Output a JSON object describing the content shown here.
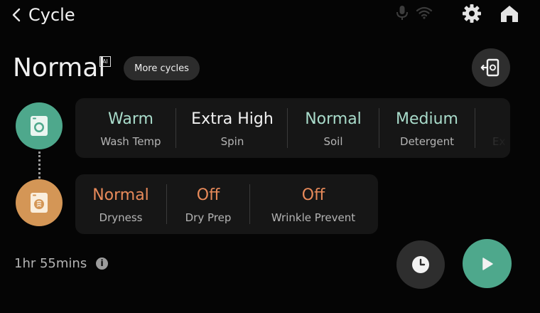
{
  "header": {
    "title": "Cycle"
  },
  "cycle": {
    "name": "Normal",
    "ai_badge": "AI",
    "more_cycles_label": "More cycles"
  },
  "washer": {
    "icon": "washer-icon",
    "options": [
      {
        "value": "Warm",
        "label": "Wash Temp",
        "color": "#a9dccb"
      },
      {
        "value": "Extra High",
        "label": "Spin",
        "color": "#f2f2f2"
      },
      {
        "value": "Normal",
        "label": "Soil",
        "color": "#a9dccb"
      },
      {
        "value": "Medium",
        "label": "Detergent",
        "color": "#a9dccb"
      },
      {
        "value": "",
        "label": "Ex",
        "color": "#a9dccb"
      }
    ]
  },
  "dryer": {
    "icon": "dryer-icon",
    "options": [
      {
        "value": "Normal",
        "label": "Dryness",
        "color": "#e88a5a"
      },
      {
        "value": "Off",
        "label": "Dry Prep",
        "color": "#e88a5a"
      },
      {
        "value": "Off",
        "label": "Wrinkle Prevent",
        "color": "#e88a5a"
      }
    ]
  },
  "footer": {
    "time": "1hr 55mins",
    "info_glyph": "i"
  },
  "colors": {
    "accent_green": "#4ea88c",
    "accent_orange": "#d49656"
  }
}
